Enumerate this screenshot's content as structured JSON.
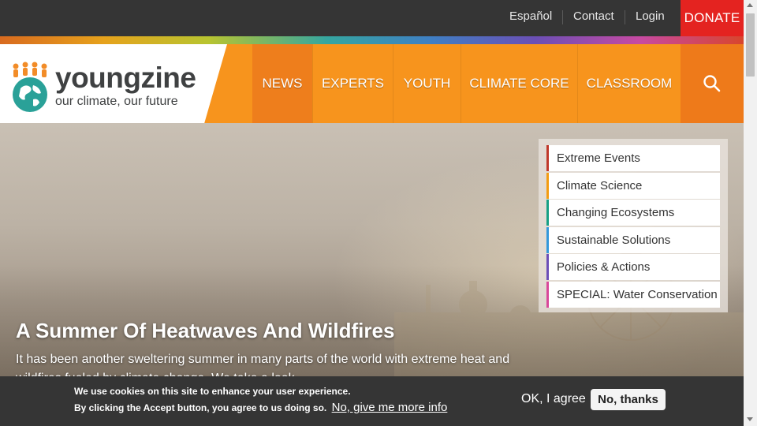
{
  "topbar": {
    "links": [
      "Español",
      "Contact",
      "Login"
    ],
    "donate_label": "DONATE"
  },
  "logo": {
    "wordmark_young": "young",
    "wordmark_zine": "zine",
    "tagline": "our climate, our future"
  },
  "nav": {
    "items": [
      "NEWS",
      "EXPERTS",
      "YOUTH",
      "CLIMATE CORE",
      "CLASSROOM"
    ],
    "search_icon": "search-icon"
  },
  "hero": {
    "title": "A Summer Of Heatwaves And Wildfires",
    "text": "It has been another sweltering summer in many parts of the world with extreme heat and wildfires fueled by climate change. We take a look..."
  },
  "topics": [
    {
      "label": "Extreme Events",
      "color": "#c0392b"
    },
    {
      "label": "Climate Science",
      "color": "#f39c12"
    },
    {
      "label": "Changing Ecosystems",
      "color": "#16a085"
    },
    {
      "label": "Sustainable Solutions",
      "color": "#3498db"
    },
    {
      "label": "Policies & Actions",
      "color": "#6c4fb8"
    },
    {
      "label": "SPECIAL: Water Conservation",
      "color": "#d9489a"
    }
  ],
  "cookie": {
    "line1": "We use cookies on this site to enhance your user experience.",
    "line2": "By clicking the Accept button, you agree to us doing so.",
    "more_info_link": "No, give me more info",
    "ok_label": "OK, I agree",
    "no_label": "No, thanks"
  },
  "colors": {
    "nav_orange": "#f7941d",
    "donate_red": "#e42320",
    "topbar_dark": "#353535"
  }
}
